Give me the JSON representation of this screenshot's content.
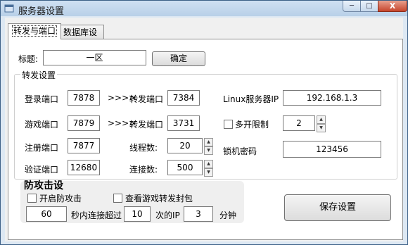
{
  "window": {
    "title": "服务器设置"
  },
  "titlebar": {
    "minimize": "─",
    "maximize": "□",
    "close": "X"
  },
  "tabs": [
    {
      "label": "转发与端口"
    },
    {
      "label": "数据库设置"
    }
  ],
  "header": {
    "title_label": "标题:",
    "title_value": "一区",
    "confirm_label": "确定"
  },
  "forward": {
    "group_label": "转发设置",
    "login_port_label": "登录端口",
    "login_port": "7878",
    "game_port_label": "游戏端口",
    "game_port": "7879",
    "register_port_label": "注册端口",
    "register_port": "7877",
    "verify_port_label": "验证端口",
    "verify_port": "12680",
    "arrow1": ">>>>",
    "arrow2": ">>>>",
    "forward_port1_label": "转发端口",
    "forward_port1": "7384",
    "forward_port2_label": "转发端口",
    "forward_port2": "3731",
    "threads_label": "线程数:",
    "threads": "20",
    "connections_label": "连接数:",
    "connections": "500",
    "linux_ip_label": "Linux服务器IP",
    "linux_ip": "192.168.1.3",
    "multi_open_label": "多开限制",
    "multi_open_checked": false,
    "multi_open_value": "2",
    "lock_password_label": "锁机密码",
    "lock_password": "123456"
  },
  "defense": {
    "title": "防攻击设",
    "enable_label": "开启防攻击",
    "enable_checked": false,
    "view_packets_label": "查看游戏转发封包",
    "view_packets_checked": false,
    "seconds": "60",
    "seconds_label": "秒内连接超过",
    "times": "10",
    "times_label": "次的IP",
    "minutes": "3",
    "minutes_label": "分钟"
  },
  "save_label": "保存设置"
}
